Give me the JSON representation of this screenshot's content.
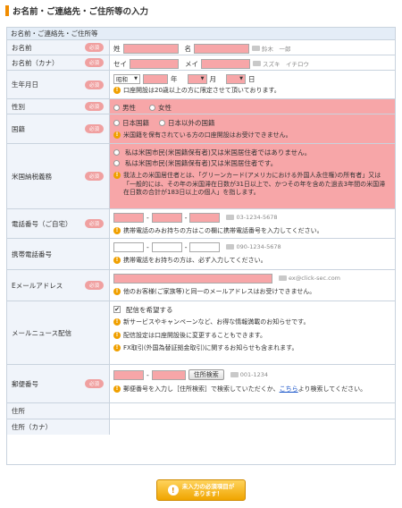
{
  "page_title": "お名前・ご連絡先・ご住所等の入力",
  "section_head": "お名前・ご連絡先・ご住所等",
  "required_label": "必須",
  "name": {
    "label": "お名前",
    "sei": "姓",
    "mei": "名",
    "example": "鈴木　一郎"
  },
  "kana": {
    "label": "お名前（カナ）",
    "sei": "セイ",
    "mei": "メイ",
    "example": "スズキ　イチロウ"
  },
  "birth": {
    "label": "生年月日",
    "era": "昭和",
    "year_unit": "年",
    "month_unit": "月",
    "day_unit": "日",
    "note": "口座開設は20歳以上の方に限定させて頂いております。"
  },
  "gender": {
    "label": "性別",
    "options": [
      "男性",
      "女性"
    ]
  },
  "nationality": {
    "label": "国籍",
    "options": [
      "日本国籍",
      "日本以外の国籍"
    ],
    "note": "米国籍を保有されている方の口座開設はお受けできません。"
  },
  "us_tax": {
    "label": "米国納税義務",
    "options": [
      "私は米国市民(米国籍保有者)又は米国居住者ではありません。",
      "私は米国市民(米国籍保有者)又は米国居住者です。"
    ],
    "note": "我法上の米国居住者とは、「グリーンカード(アメリカにおける外国人永住権)の所有者」又は「一般的には、その年の米国滞在日数が31日以上で、かつその年を含めた過去3年間の米国滞在日数の合計が183日以上の個人」を指します。"
  },
  "phone": {
    "label": "電話番号（ご自宅）",
    "example": "03-1234-5678",
    "note": "携帯電話のみお持ちの方はこの欄に携帯電話番号を入力してください。"
  },
  "mobile": {
    "label": "携帯電話番号",
    "example": "090-1234-5678",
    "note": "携帯電話をお持ちの方は、必ず入力してください。"
  },
  "email": {
    "label": "Eメールアドレス",
    "example": "ex@click-sec.com",
    "note": "他のお客様(ご家族等)と同一のメールアドレスはお受けできません。"
  },
  "newsletter": {
    "label": "メールニュース配信",
    "checkbox": "配信を希望する",
    "notes": [
      "新サービスやキャンペーンなど、お得な情報満載のお知らせです。",
      "配信設定は口座開設後に変更することもできます。",
      "FX取引(外国為替証拠金取引)に関するお知らせも含まれます。"
    ]
  },
  "postal": {
    "label": "郵便番号",
    "button": "住所検索",
    "example": "001-1234",
    "note_pre": "郵便番号を入力し［住所検索］で検索していただくか、",
    "note_link": "こちら",
    "note_post": "より検索してください。"
  },
  "address": {
    "label": "住所"
  },
  "address_kana": {
    "label": "住所（カナ）"
  },
  "submit": {
    "line1": "未入力の必須項目が",
    "line2": "あります！"
  }
}
